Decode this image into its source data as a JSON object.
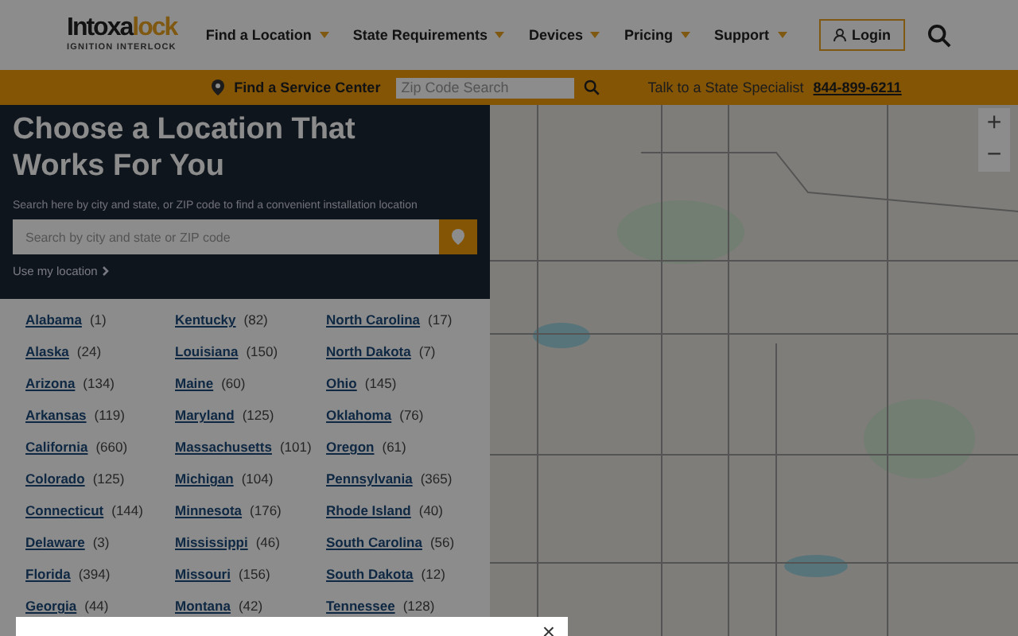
{
  "header": {
    "logo": {
      "wordmark": [
        "Intoxa",
        "lock"
      ],
      "tagline": "IGNITION INTERLOCK"
    },
    "nav": [
      {
        "label": "Find a Location"
      },
      {
        "label": "State Requirements"
      },
      {
        "label": "Devices"
      },
      {
        "label": "Pricing"
      },
      {
        "label": "Support"
      }
    ],
    "login": "Login"
  },
  "service_bar": {
    "label": "Find a Service Center",
    "zip_field": {
      "placeholder": "Zip Code Search"
    },
    "specialist": "Talk to a State Specialist",
    "phone": "844-899-6211"
  },
  "locator": {
    "title": "Choose a Location That Works For You",
    "subtitle": "Search here by city and state, or ZIP code to find a convenient installation location",
    "search": {
      "placeholder": "Search by city and state or ZIP code"
    },
    "use_location": "Use my location"
  },
  "states": [
    {
      "name": "Alabama",
      "count": "(1)"
    },
    {
      "name": "Alaska",
      "count": "(24)"
    },
    {
      "name": "Arizona",
      "count": "(134)"
    },
    {
      "name": "Arkansas",
      "count": "(119)"
    },
    {
      "name": "California",
      "count": "(660)"
    },
    {
      "name": "Colorado",
      "count": "(125)"
    },
    {
      "name": "Connecticut",
      "count": "(144)"
    },
    {
      "name": "Delaware",
      "count": "(3)"
    },
    {
      "name": "Florida",
      "count": "(394)"
    },
    {
      "name": "Georgia",
      "count": "(44)"
    },
    {
      "name": "Kentucky",
      "count": "(82)"
    },
    {
      "name": "Louisiana",
      "count": "(150)"
    },
    {
      "name": "Maine",
      "count": "(60)"
    },
    {
      "name": "Maryland",
      "count": "(125)"
    },
    {
      "name": "Massachusetts",
      "count": "(101)"
    },
    {
      "name": "Michigan",
      "count": "(104)"
    },
    {
      "name": "Minnesota",
      "count": "(176)"
    },
    {
      "name": "Mississippi",
      "count": "(46)"
    },
    {
      "name": "Missouri",
      "count": "(156)"
    },
    {
      "name": "Montana",
      "count": "(42)"
    },
    {
      "name": "North Carolina",
      "count": "(17)"
    },
    {
      "name": "North Dakota",
      "count": "(7)"
    },
    {
      "name": "Ohio",
      "count": "(145)"
    },
    {
      "name": "Oklahoma",
      "count": "(76)"
    },
    {
      "name": "Oregon",
      "count": "(61)"
    },
    {
      "name": "Pennsylvania",
      "count": "(365)"
    },
    {
      "name": "Rhode Island",
      "count": "(40)"
    },
    {
      "name": "South Carolina",
      "count": "(56)"
    },
    {
      "name": "South Dakota",
      "count": "(12)"
    },
    {
      "name": "Tennessee",
      "count": "(128)"
    }
  ],
  "map": {
    "zoom_in": "+",
    "zoom_out": "−"
  },
  "modal": {
    "close": "×"
  }
}
